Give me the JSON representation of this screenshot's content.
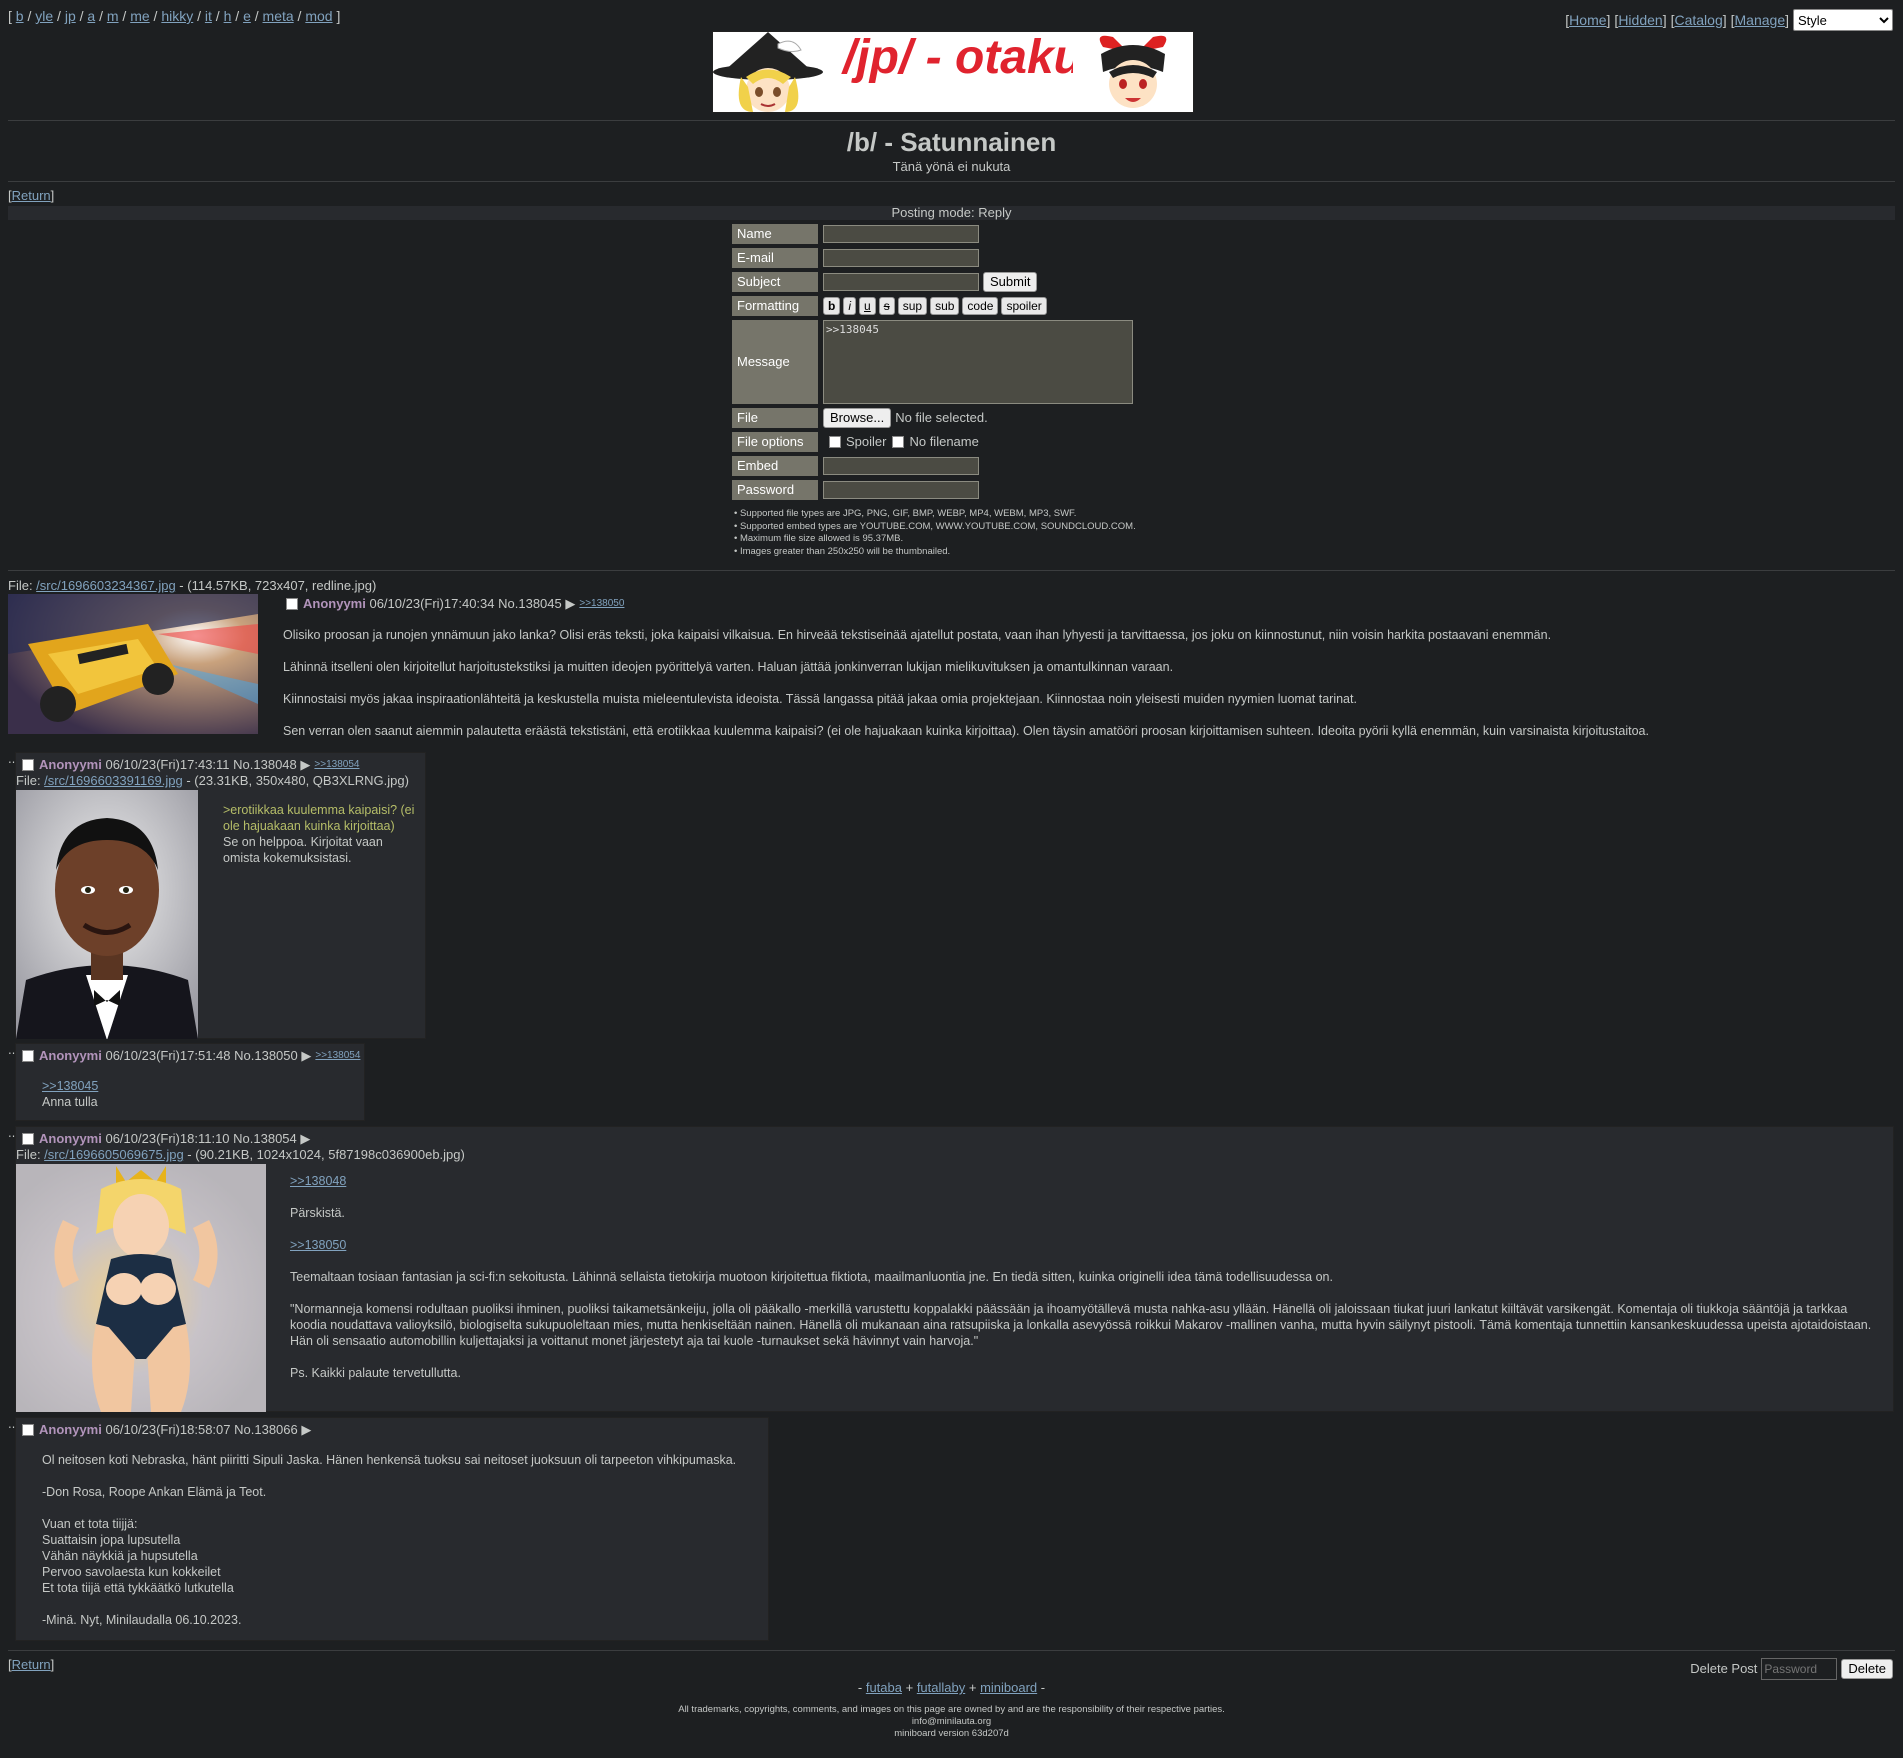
{
  "nav": {
    "boards": [
      "b",
      "yle",
      "jp",
      "a",
      "m",
      "me",
      "hikky",
      "it",
      "h",
      "e",
      "meta",
      "mod"
    ],
    "right_links": [
      "Home",
      "Hidden",
      "Catalog",
      "Manage"
    ],
    "style_select": "Style"
  },
  "banner": {
    "text": "/jp/ - otaku"
  },
  "board": {
    "title": "/b/ - Satunnainen",
    "subtitle": "Tänä yönä ei nukuta"
  },
  "return_label": "Return",
  "posting_mode": "Posting mode: Reply",
  "form": {
    "labels": {
      "name": "Name",
      "email": "E-mail",
      "subject": "Subject",
      "formatting": "Formatting",
      "message": "Message",
      "file": "File",
      "file_options": "File options",
      "embed": "Embed",
      "password": "Password"
    },
    "submit": "Submit",
    "format_buttons": [
      "b",
      "i",
      "u",
      "s",
      "sup",
      "sub",
      "code",
      "spoiler"
    ],
    "message_value": ">>138045",
    "browse": "Browse...",
    "no_file": "No file selected.",
    "spoiler": "Spoiler",
    "no_filename": "No filename",
    "rules": [
      "Supported file types are JPG, PNG, GIF, BMP, WEBP, MP4, WEBM, MP3, SWF.",
      "Supported embed types are YOUTUBE.COM, WWW.YOUTUBE.COM, SOUNDCLOUD.COM.",
      "Maximum file size allowed is 95.37MB.",
      "Images greater than 250x250 will be thumbnailed."
    ]
  },
  "op": {
    "file_prefix": "File: ",
    "file_link": "/src/1696603234367.jpg",
    "file_info": " - (114.57KB, 723x407, redline.jpg)",
    "name": "Anonyymi",
    "date": "06/10/23(Fri)17:40:34",
    "no": "No.138045",
    "backlink": ">>138050",
    "paragraphs": [
      "Olisiko proosan ja runojen ynnämuun jako lanka? Olisi eräs teksti, joka kaipaisi vilkaisua. En hirveää tekstiseinää ajatellut postata, vaan ihan lyhyesti ja tarvittaessa, jos joku on kiinnostunut, niin voisin harkita postaavani enemmän.",
      "Lähinnä itselleni olen kirjoitellut harjoitustekstiksi ja muitten ideojen pyörittelyä varten. Haluan jättää jonkinverran lukijan mielikuvituksen ja omantulkinnan varaan.",
      "Kiinnostaisi myös jakaa inspiraationlähteitä ja keskustella muista mieleentulevista ideoista. Tässä langassa pitää jakaa omia projektejaan. Kiinnostaa noin yleisesti muiden nyymien luomat tarinat.",
      "Sen verran olen saanut aiemmin palautetta eräästä tekstistäni, että erotiikkaa kuulemma kaipaisi? (ei ole hajuakaan kuinka kirjoittaa). Olen täysin amatööri proosan kirjoittamisen suhteen. Ideoita pyörii kyllä enemmän, kuin varsinaista kirjoitustaitoa."
    ]
  },
  "replies": [
    {
      "name": "Anonyymi",
      "date": "06/10/23(Fri)17:43:11",
      "no": "No.138048",
      "backlink": ">>138054",
      "file_prefix": "File: ",
      "file_link": "/src/1696603391169.jpg",
      "file_info": " - (23.31KB, 350x480, QB3XLRNG.jpg)",
      "quote": ">erotiikkaa kuulemma kaipaisi? (ei ole hajuakaan kuinka kirjoittaa)",
      "text": "Se on helppoa. Kirjoitat vaan omista kokemuksistasi."
    },
    {
      "name": "Anonyymi",
      "date": "06/10/23(Fri)17:51:48",
      "no": "No.138050",
      "backlink": ">>138054",
      "link": ">>138045",
      "text": "Anna tulla"
    },
    {
      "name": "Anonyymi",
      "date": "06/10/23(Fri)18:11:10",
      "no": "No.138054",
      "file_prefix": "File: ",
      "file_link": "/src/1696605069675.jpg",
      "file_info": " - (90.21KB, 1024x1024, 5f87198c036900eb.jpg)",
      "link1": ">>138048",
      "p1": "Pärskistä.",
      "link2": ">>138050",
      "p2": "Teemaltaan tosiaan fantasian ja sci-fi:n sekoitusta. Lähinnä sellaista tietokirja muotoon kirjoitettua fiktiota, maailmanluontia jne. En tiedä sitten, kuinka originelli idea tämä todellisuudessa on.",
      "p3": "\"Normanneja komensi rodultaan puoliksi ihminen, puoliksi taikametsänkeiju, jolla oli pääkallo -merkillä varustettu koppalakki päässään ja ihoamyötällevä musta nahka-asu yllään. Hänellä oli jaloissaan tiukat juuri lankatut kiiltävät varsikengät. Komentaja oli tiukkoja sääntöjä ja tarkkaa koodia noudattava valioyksilö, biologiselta sukupuoleltaan mies, mutta henkiseltään nainen. Hänellä oli mukanaan aina ratsupiiska ja lonkalla asevyössä roikkui Makarov -mallinen vanha, mutta hyvin säilynyt pistooli. Tämä komentaja tunnettiin kansankeskuudessa upeista ajotaidoistaan. Hän oli sensaatio automobillin kuljettajaksi ja voittanut monet järjestetyt aja tai kuole -turnaukset sekä hävinnyt vain harvoja.\"",
      "p4": "Ps. Kaikki palaute tervetullutta."
    },
    {
      "name": "Anonyymi",
      "date": "06/10/23(Fri)18:58:07",
      "no": "No.138066",
      "p1": "Ol neitosen koti Nebraska, hänt piiritti Sipuli Jaska. Hänen henkensä tuoksu sai neitoset juoksuun oli tarpeeton vihkipumaska.",
      "p2": "-Don Rosa, Roope Ankan Elämä ja Teot.",
      "lines": [
        "Vuan et tota tiijjä:",
        "Suattaisin jopa lupsutella",
        "Vähän näykkiä ja hupsutella",
        "Pervoo savolaesta kun kokkeilet",
        "Et tota tiijä että tykkäätkö lutkutella"
      ],
      "p3": "-Minä. Nyt, Minilaudalla 06.10.2023."
    }
  ],
  "delete": {
    "label": "Delete Post",
    "placeholder": "Password",
    "button": "Delete"
  },
  "footer": {
    "links": [
      "futaba",
      "futallaby",
      "miniboard"
    ],
    "legal": "All trademarks, copyrights, comments, and images on this page are owned by and are the responsibility of their respective parties.",
    "email": "info@minilauta.org",
    "version": "miniboard version 63d207d"
  },
  "colors": {
    "bg": "#1d1f21",
    "reply_bg": "#282a2e",
    "name": "#b294bb",
    "link": "#81a2be",
    "quote": "#b5bd68",
    "label_bg": "#76756a"
  }
}
